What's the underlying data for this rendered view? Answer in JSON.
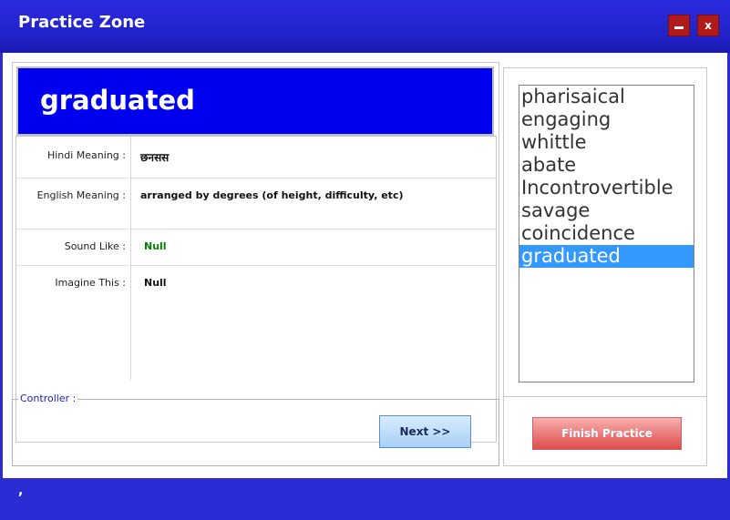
{
  "window": {
    "title": "Practice Zone",
    "minimize_glyph": "",
    "close_label": "x"
  },
  "word": "graduated",
  "details": {
    "hindi_label": "Hindi Meaning :",
    "hindi_value": "छनसस",
    "english_label": "English Meaning :",
    "english_value": "arranged by degrees (of height, difficulty, etc)",
    "sound_label": "Sound Like :",
    "sound_value": "Null",
    "imagine_label": "Imagine This :",
    "imagine_value": "Null"
  },
  "controller": {
    "legend": "Controller :",
    "next_label": "Next >>"
  },
  "word_list": {
    "items": [
      "pharisaical",
      "engaging",
      "whittle",
      "abate",
      "Incontrovertible",
      "savage",
      "coincidence",
      "graduated"
    ],
    "selected": "graduated"
  },
  "finish_label": "Finish Practice",
  "status_text": ",",
  "colors": {
    "title_bar": "#2222c8",
    "word_header": "#0000f0",
    "selection": "#3399ff",
    "sound_value": "#008000",
    "finish_button": "#e04b4b"
  }
}
